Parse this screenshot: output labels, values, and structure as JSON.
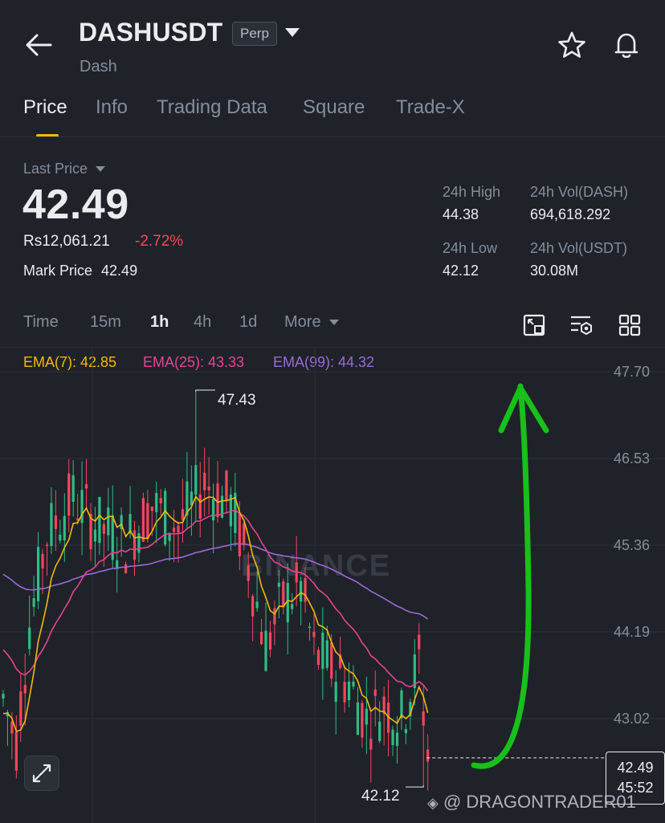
{
  "header": {
    "title": "DASHUSDT",
    "badge": "Perp",
    "subtitle": "Dash"
  },
  "tabs": [
    {
      "label": "Price",
      "active": true
    },
    {
      "label": "Info"
    },
    {
      "label": "Trading Data"
    },
    {
      "label": "Square"
    },
    {
      "label": "Trade-X"
    }
  ],
  "ticker": {
    "last_price_label": "Last Price",
    "last_price": "42.49",
    "fiat_price": "Rs12,061.21",
    "change_pct": "-2.72%",
    "mark_label": "Mark Price",
    "mark_price": "42.49"
  },
  "stats": {
    "high_label": "24h High",
    "high": "44.38",
    "low_label": "24h Low",
    "low": "42.12",
    "vol_base_label": "24h Vol(DASH)",
    "vol_base": "694,618.292",
    "vol_quote_label": "24h Vol(USDT)",
    "vol_quote": "30.08M"
  },
  "intervals": [
    {
      "label": "Time"
    },
    {
      "label": "15m"
    },
    {
      "label": "1h",
      "active": true
    },
    {
      "label": "4h"
    },
    {
      "label": "1d"
    },
    {
      "label": "More"
    }
  ],
  "ema": {
    "ema7": "EMA(7): 42.85",
    "ema25": "EMA(25): 43.33",
    "ema99": "EMA(99): 44.32"
  },
  "colors": {
    "up": "#2ebd85",
    "down": "#f6465d",
    "accent": "#f0b90b",
    "ema7": "#f0b90b",
    "ema25": "#e84393",
    "ema99": "#9b6ad6",
    "annotation": "#18c01a"
  },
  "chart": {
    "y_ticks": [
      "47.70",
      "46.53",
      "45.36",
      "44.19",
      "43.02"
    ],
    "max_label": "47.43",
    "min_label": "42.12",
    "current_price": "42.49",
    "countdown": "45:52",
    "watermark": "BINANCE",
    "credit": "@ DRAGONTRADER01"
  },
  "chart_data": {
    "type": "candlestick",
    "y_ticks": [
      47.7,
      46.53,
      45.36,
      44.19,
      43.02
    ],
    "ylim": [
      41.8,
      47.9
    ],
    "high": 47.43,
    "low": 42.12,
    "last": 42.49,
    "ema": {
      "ema7": 42.85,
      "ema25": 43.33,
      "ema99": 44.32
    }
  }
}
